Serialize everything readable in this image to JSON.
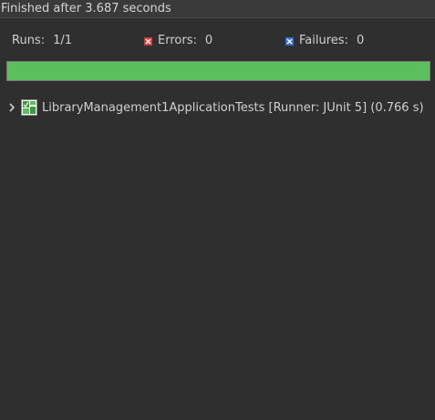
{
  "status": {
    "text": "Finished after 3.687 seconds"
  },
  "counters": {
    "runs_label": "Runs:",
    "runs_value": "1/1",
    "errors_label": "Errors:",
    "errors_value": "0",
    "failures_label": "Failures:",
    "failures_value": "0"
  },
  "progress": {
    "fraction": 1.0,
    "color": "#5cbf5e"
  },
  "tree": {
    "items": [
      {
        "label": "LibraryManagement1ApplicationTests [Runner: JUnit 5] (0.766 s)",
        "icon": "test-suite-icon",
        "expanded": false
      }
    ]
  },
  "colors": {
    "background": "#2f2f2f",
    "error_icon": "#d63b3b",
    "failure_icon": "#3b6fd6",
    "success": "#5cbf5e"
  }
}
